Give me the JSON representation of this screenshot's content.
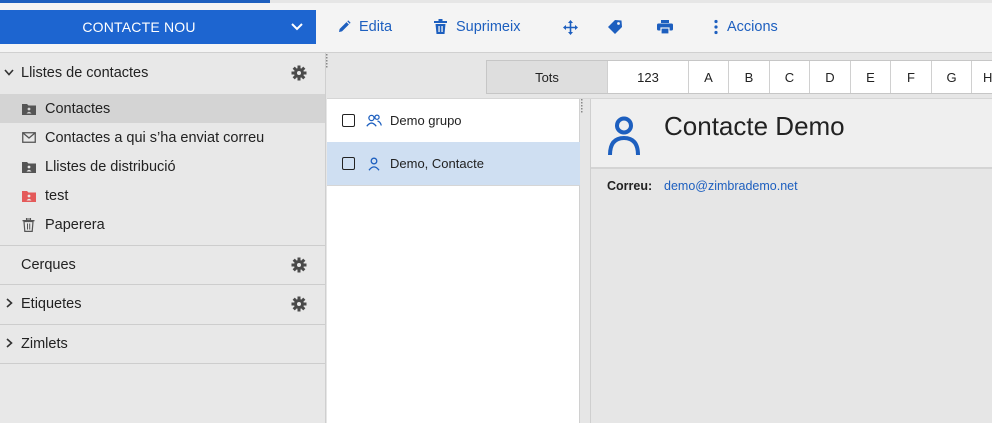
{
  "toolbar": {
    "new_contact": "CONTACTE NOU",
    "edit": "Edita",
    "delete": "Suprimeix",
    "actions": "Accions"
  },
  "sidebar": {
    "contact_lists_header": "Llistes de contactes",
    "folders": [
      {
        "label": "Contactes",
        "icon": "contacts-folder-icon",
        "selected": true
      },
      {
        "label": "Contactes a qui s’ha enviat correu",
        "icon": "envelope-icon",
        "selected": false
      },
      {
        "label": "Llistes de distribució",
        "icon": "contacts-folder-icon",
        "selected": false
      },
      {
        "label": "test",
        "icon": "contacts-folder-red-icon",
        "selected": false,
        "color": "#e45a5a"
      },
      {
        "label": "Paperera",
        "icon": "trash-icon",
        "selected": false
      }
    ],
    "searches_header": "Cerques",
    "tags_header": "Etiquetes",
    "zimlets_header": "Zimlets"
  },
  "alphabet": {
    "cells": [
      "Tots",
      "123",
      "A",
      "B",
      "C",
      "D",
      "E",
      "F",
      "G",
      "H"
    ],
    "selected": "Tots"
  },
  "contact_list": [
    {
      "name": "Demo grupo",
      "type": "group",
      "selected": false
    },
    {
      "name": "Demo, Contacte",
      "type": "person",
      "selected": true
    }
  ],
  "detail": {
    "title": "Contacte Demo",
    "email_label": "Correu:",
    "email_value": "demo@zimbrademo.net"
  },
  "colors": {
    "accent": "#1d65d0",
    "selection": "#cfdff2",
    "link": "#1d5fbf"
  }
}
